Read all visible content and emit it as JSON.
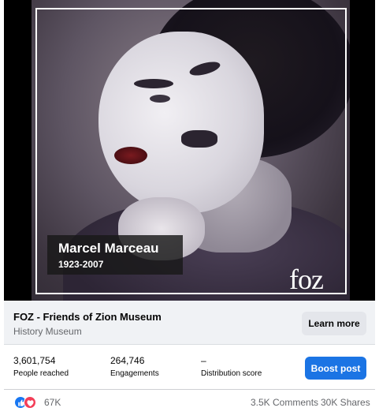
{
  "media": {
    "caption_name": "Marcel Marceau",
    "caption_years": "1923-2007",
    "logo_text": "foz"
  },
  "link": {
    "title": "FOZ - Friends of Zion Museum",
    "subtitle": "History Museum",
    "cta_label": "Learn more"
  },
  "stats": [
    {
      "value": "3,601,754",
      "label": "People reached"
    },
    {
      "value": "264,746",
      "label": "Engagements"
    },
    {
      "value": "–",
      "label": "Distribution score"
    }
  ],
  "boost_label": "Boost post",
  "reactions": {
    "icons": [
      "like-icon",
      "love-icon"
    ],
    "count": "67K",
    "comments": "3.5K Comments",
    "shares": "30K Shares"
  },
  "colors": {
    "accent": "#1b74e4",
    "like": "#1877f2",
    "love": "#f33e58"
  }
}
